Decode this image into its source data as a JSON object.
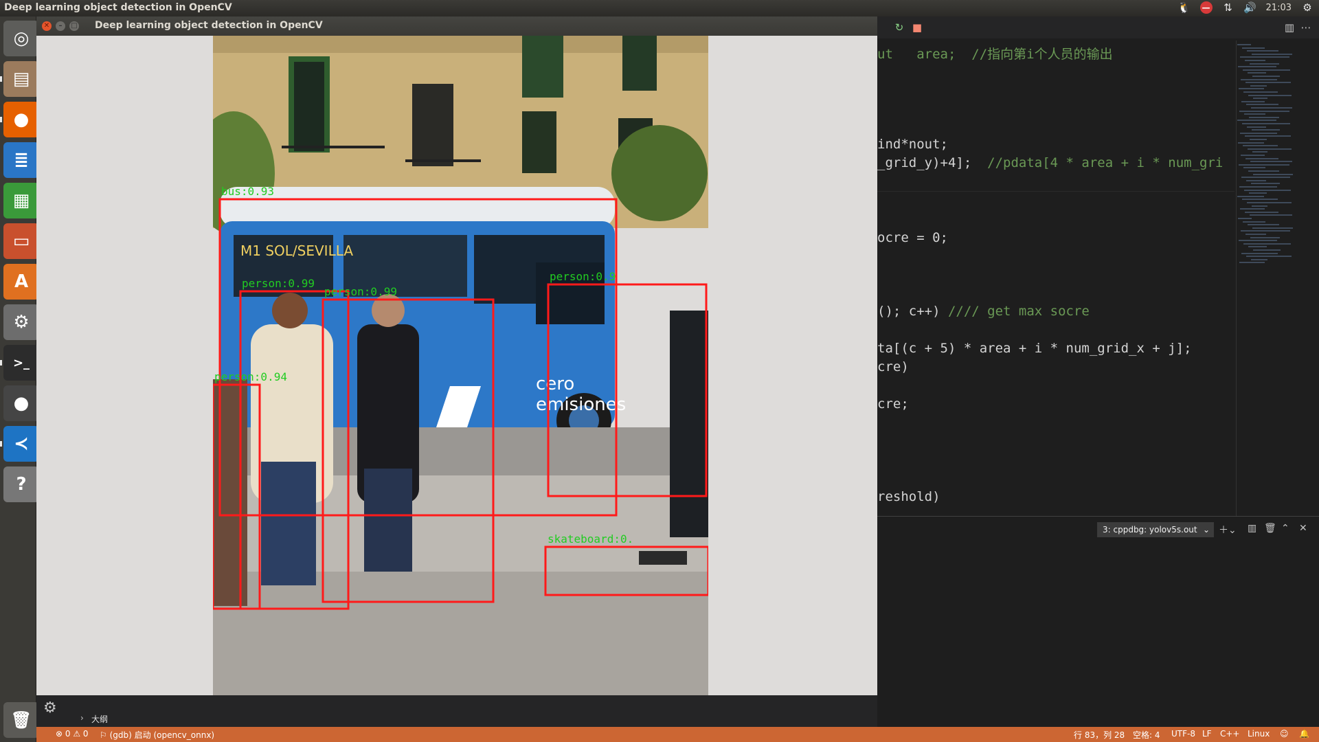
{
  "topbar": {
    "title": "Deep learning object detection in OpenCV",
    "time": "21:03"
  },
  "launcher": {
    "items": [
      {
        "name": "ubuntu-dash-icon",
        "glyph": "◎",
        "bg": "#5d5d5a"
      },
      {
        "name": "files-icon",
        "glyph": "▤",
        "bg": "#9b7b5d"
      },
      {
        "name": "firefox-icon",
        "glyph": "●",
        "bg": "#e66000"
      },
      {
        "name": "writer-icon",
        "glyph": "≣",
        "bg": "#2a76c6"
      },
      {
        "name": "calc-icon",
        "glyph": "▦",
        "bg": "#3a9a3a"
      },
      {
        "name": "impress-icon",
        "glyph": "▭",
        "bg": "#c9502d"
      },
      {
        "name": "software-center-icon",
        "glyph": "A",
        "bg": "#e07020"
      },
      {
        "name": "settings-icon",
        "glyph": "⚙",
        "bg": "#6d6d6d"
      },
      {
        "name": "terminal-icon",
        "glyph": ">_",
        "bg": "#2c2c2c"
      },
      {
        "name": "qq-icon",
        "glyph": "●",
        "bg": "#454545"
      },
      {
        "name": "vscode-icon",
        "glyph": "≺",
        "bg": "#1e74c4"
      },
      {
        "name": "help-icon",
        "glyph": "?",
        "bg": "#777"
      }
    ],
    "trash": "🗑"
  },
  "cv_window": {
    "title": "Deep learning object detection in OpenCV",
    "detections": [
      {
        "label": "bus:0.93"
      },
      {
        "label": "person:0.99"
      },
      {
        "label": "person:0.99"
      },
      {
        "label": "person:0.94"
      },
      {
        "label": "person:0.9"
      },
      {
        "label": "skateboard:0."
      }
    ]
  },
  "editor": {
    "lines": [
      {
        "text": "ut   area;  //指向第i个人员的输出",
        "cls": "cm"
      },
      {
        "text": "ind*nout;",
        "cls": ""
      },
      {
        "text": "_grid_y)+4];  //pdata[4 * area + i * num_gri",
        "cls": "mix"
      },
      {
        "text": "ocre = 0;",
        "cls": ""
      },
      {
        "text": "(); c++) //// get max socre",
        "cls": "mix2"
      },
      {
        "text": "ta[(c + 5) * area + i * num_grid_x + j];",
        "cls": ""
      },
      {
        "text": "cre)",
        "cls": ""
      },
      {
        "text": "cre;",
        "cls": ""
      },
      {
        "text": "reshold)",
        "cls": ""
      }
    ]
  },
  "panel": {
    "terminal_select": "3: cppdbg: yolov5s.out"
  },
  "outline": {
    "label": "大纲"
  },
  "statusbar": {
    "errors": "⊗ 0 ⚠ 0",
    "debug": "(gdb) 启动 (opencv_onnx)",
    "position": "行 83，列 28",
    "spaces": "空格: 4",
    "encoding": "UTF-8",
    "eol": "LF",
    "language": "C++",
    "os": "Linux"
  }
}
